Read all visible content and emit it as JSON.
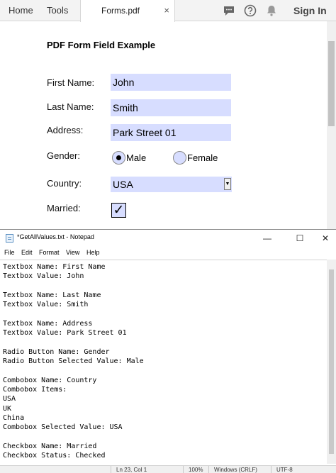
{
  "acrobat": {
    "nav": {
      "home": "Home",
      "tools": "Tools"
    },
    "tab": {
      "title": "Forms.pdf",
      "close": "×"
    },
    "sign_in": "Sign In",
    "icons": [
      "comment-icon",
      "help-icon",
      "bell-icon"
    ],
    "form": {
      "title": "PDF Form Field Example",
      "first_name_label": "First Name:",
      "first_name_value": "John",
      "last_name_label": "Last Name:",
      "last_name_value": "Smith",
      "address_label": "Address:",
      "address_value": "Park Street 01",
      "gender_label": "Gender:",
      "gender_options": [
        "Male",
        "Female"
      ],
      "gender_selected": "Male",
      "country_label": "Country:",
      "country_value": "USA",
      "married_label": "Married:",
      "married_checked": true
    },
    "colors": {
      "field_bg": "#d7ddff",
      "bar_bg": "#f3f3f3"
    }
  },
  "notepad": {
    "title": "*GetAllValues.txt - Notepad",
    "window_buttons": {
      "minimize": "—",
      "maximize": "☐",
      "close": "✕"
    },
    "menu": [
      "File",
      "Edit",
      "Format",
      "View",
      "Help"
    ],
    "lines": [
      "Textbox Name: First Name",
      "Textbox Value: John",
      "",
      "Textbox Name: Last Name",
      "Textbox Value: Smith",
      "",
      "Textbox Name: Address",
      "Textbox Value: Park Street 01",
      "",
      "Radio Button Name: Gender",
      "Radio Button Selected Value: Male",
      "",
      "Combobox Name: Country",
      "Combobox Items:",
      "USA",
      "UK",
      "China",
      "Combobox Selected Value: USA",
      "",
      "Checkbox Name: Married",
      "Checkbox Status: Checked"
    ],
    "status": {
      "position": "Ln 23, Col 1",
      "zoom": "100%",
      "line_endings": "Windows (CRLF)",
      "encoding": "UTF-8"
    }
  }
}
